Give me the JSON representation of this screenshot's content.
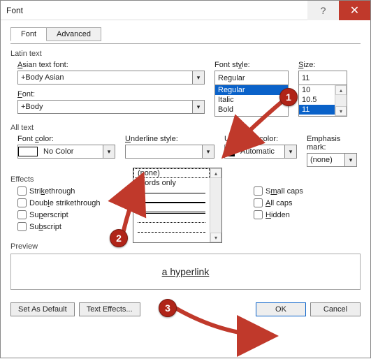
{
  "title": "Font",
  "tabs": {
    "font": "Font",
    "advanced": "Advanced"
  },
  "groups": {
    "latin": "Latin text",
    "alltext": "All text",
    "effects": "Effects",
    "preview": "Preview"
  },
  "labels": {
    "asian_font": "Asian text font:",
    "font": "Font:",
    "font_style": "Font style:",
    "size": "Size:",
    "font_color": "Font color:",
    "underline_style": "Underline style:",
    "underline_color": "Underline color:",
    "emphasis_mark": "Emphasis mark:"
  },
  "values": {
    "asian_font": "+Body Asian",
    "font": "+Body",
    "font_style": "Regular",
    "size": "11",
    "font_color": "No Color",
    "underline_color": "Automatic",
    "emphasis_mark": "(none)"
  },
  "font_style_list": [
    "Regular",
    "Italic",
    "Bold"
  ],
  "size_list": [
    "10",
    "10.5",
    "11"
  ],
  "underline_popup": {
    "none": "(none)",
    "words": "Words only"
  },
  "effects": {
    "strike": "Strikethrough",
    "dblstrike": "Double strikethrough",
    "super": "Superscript",
    "sub": "Subscript",
    "smallcaps": "Small caps",
    "allcaps": "All caps",
    "hidden": "Hidden"
  },
  "preview_text": "a hyperlink",
  "buttons": {
    "set_default": "Set As Default",
    "text_effects": "Text Effects...",
    "ok": "OK",
    "cancel": "Cancel"
  },
  "markers": {
    "m1": "1",
    "m2": "2",
    "m3": "3"
  }
}
